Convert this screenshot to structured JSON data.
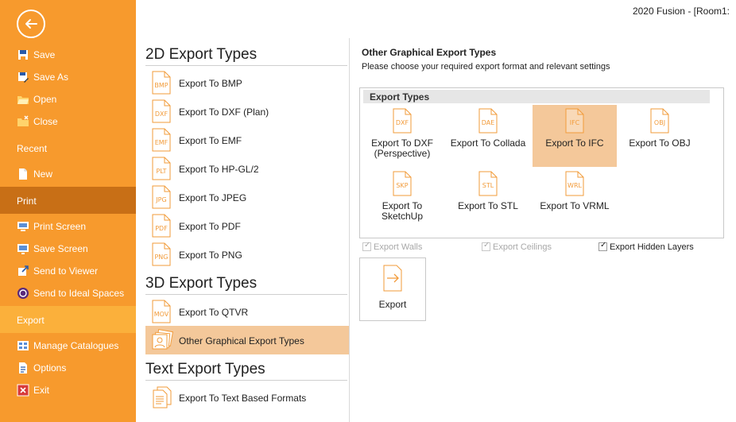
{
  "window": {
    "title": "2020 Fusion - [Room1:"
  },
  "sidebar": {
    "accent": "#f79a2d",
    "items": [
      {
        "label": "Save",
        "icon": "save-icon"
      },
      {
        "label": "Save As",
        "icon": "save-as-icon"
      },
      {
        "label": "Open",
        "icon": "folder-open-icon"
      },
      {
        "label": "Close",
        "icon": "folder-close-icon"
      },
      {
        "label": "Recent"
      },
      {
        "label": "New",
        "icon": "new-document-icon"
      },
      {
        "label": "Print"
      },
      {
        "label": "Print Screen",
        "icon": "print-screen-icon"
      },
      {
        "label": "Save Screen",
        "icon": "save-screen-icon"
      },
      {
        "label": "Send to Viewer",
        "icon": "send-to-viewer-icon"
      },
      {
        "label": "Send to Ideal Spaces",
        "icon": "ideal-spaces-icon"
      },
      {
        "label": "Export"
      },
      {
        "label": "Manage Catalogues",
        "icon": "catalogues-icon"
      },
      {
        "label": "Options",
        "icon": "options-icon"
      },
      {
        "label": "Exit",
        "icon": "exit-icon"
      }
    ]
  },
  "middle": {
    "groups": [
      {
        "heading": "2D Export Types",
        "items": [
          {
            "label": "Export To BMP",
            "ext": "BMP"
          },
          {
            "label": "Export To DXF (Plan)",
            "ext": "DXF"
          },
          {
            "label": "Export To EMF",
            "ext": "EMF"
          },
          {
            "label": "Export To HP-GL/2",
            "ext": "PLT"
          },
          {
            "label": "Export To JPEG",
            "ext": "JPG"
          },
          {
            "label": "Export To PDF",
            "ext": "PDF"
          },
          {
            "label": "Export To PNG",
            "ext": "PNG"
          }
        ]
      },
      {
        "heading": "3D Export Types",
        "items": [
          {
            "label": "Export To QTVR",
            "ext": "MOV"
          },
          {
            "label": "Other Graphical Export Types",
            "selected": true
          }
        ]
      },
      {
        "heading": "Text Export Types",
        "items": [
          {
            "label": "Export To Text Based Formats"
          }
        ]
      }
    ]
  },
  "right": {
    "title": "Other Graphical Export Types",
    "subtitle": "Please choose your required export format and relevant settings",
    "box_header": "Export Types",
    "types": [
      {
        "ext": "DXF",
        "label": "Export To DXF (Perspective)"
      },
      {
        "ext": "DAE",
        "label": "Export To Collada"
      },
      {
        "ext": "IFC",
        "label": "Export To IFC",
        "selected": true
      },
      {
        "ext": "OBJ",
        "label": "Export To OBJ"
      },
      {
        "ext": "SKP",
        "label": "Export To SketchUp"
      },
      {
        "ext": "STL",
        "label": "Export To STL"
      },
      {
        "ext": "WRL",
        "label": "Export To VRML"
      }
    ],
    "options": [
      {
        "label": "Export Walls",
        "checked": true,
        "enabled": false
      },
      {
        "label": "Export Ceilings",
        "checked": true,
        "enabled": false
      },
      {
        "label": "Export Hidden Layers",
        "checked": true,
        "enabled": true
      }
    ],
    "export_button": "Export"
  }
}
